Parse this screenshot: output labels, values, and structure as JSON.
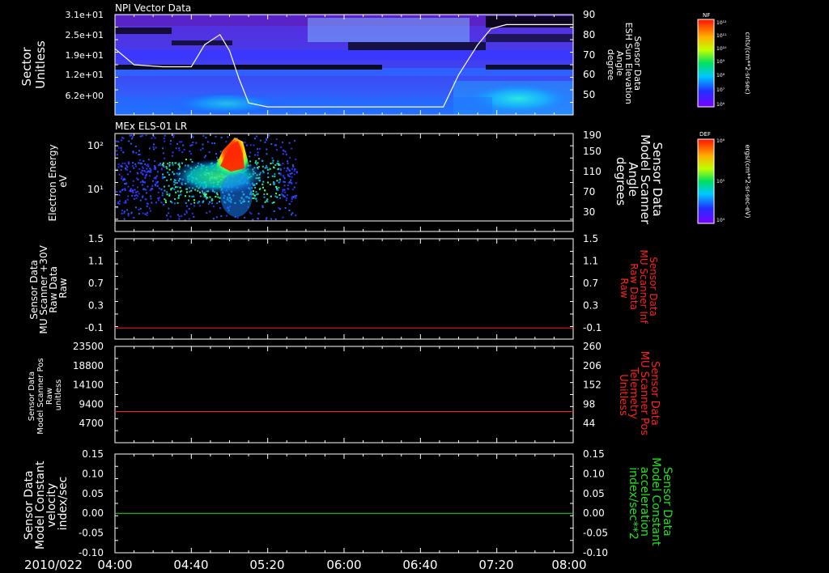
{
  "date_label": "2010/022",
  "time_ticks": [
    "04:00",
    "04:40",
    "05:20",
    "06:00",
    "06:40",
    "07:20",
    "08:00"
  ],
  "colors": {
    "frame": "#ffffff",
    "red": "#ff2020",
    "green": "#20e020",
    "background": "#000000"
  },
  "chart_data": [
    {
      "type": "heatmap",
      "title": "NPI Vector Data",
      "ylabel": [
        "Sector",
        "Unitless"
      ],
      "left_ticks": [
        "3.1e+01",
        "2.5e+01",
        "1.9e+01",
        "1.2e+01",
        "6.2e+00"
      ],
      "right_ticks": [
        "90",
        "80",
        "70",
        "60",
        "50"
      ],
      "right_label": [
        "Sensor Data",
        "ESH Sun Elevation",
        "Angle",
        "degree"
      ],
      "x": [
        "04:00",
        "08:00"
      ],
      "overlay_line": {
        "name": "ESH Sun Elevation",
        "x": [
          "04:00",
          "04:10",
          "04:25",
          "04:40",
          "04:47",
          "04:55",
          "05:00",
          "05:05",
          "05:10",
          "05:20",
          "06:00",
          "06:40",
          "06:52",
          "07:00",
          "07:10",
          "07:17",
          "07:25",
          "08:00"
        ],
        "y": [
          73,
          65,
          64,
          64,
          75,
          80,
          72,
          58,
          46,
          44,
          44,
          44,
          44,
          60,
          75,
          83,
          85,
          85
        ]
      },
      "colorbar": {
        "label": "NF",
        "tick_labels": [
          "10¹²",
          "10¹¹",
          "10¹⁰",
          "10⁹",
          "10⁸",
          "10⁷",
          "10⁶"
        ],
        "units": "cnts/(cm**2-sr-sec)"
      }
    },
    {
      "type": "heatmap",
      "title": "MEx ELS-01 LR",
      "ylabel": [
        "Electron Energy",
        "eV"
      ],
      "left_ticks": [
        "10²",
        "10¹"
      ],
      "right_ticks": [
        "190",
        "150",
        "110",
        "70",
        "30"
      ],
      "right_label": [
        "Sensor Data",
        "Model Scanner",
        "Angle",
        "degrees"
      ],
      "data_extent": [
        "04:00",
        "05:35"
      ],
      "overlay_line": {
        "name": "Model Scanner Angle",
        "y": 10
      },
      "colorbar": {
        "label": "DEF",
        "tick_labels": [
          "10⁶",
          "10⁵",
          "10⁴"
        ],
        "units": "ergs/(cm**2-sr-sec-eV)"
      }
    },
    {
      "type": "line",
      "ylabel": [
        "Sensor Data",
        "MU Scanner +30V",
        "Raw Data",
        "Raw"
      ],
      "left_ticks": [
        "1.5",
        "1.1",
        "0.7",
        "0.3",
        "-0.1"
      ],
      "right_ticks": [
        "1.5",
        "1.1",
        "0.7",
        "0.3",
        "-0.1"
      ],
      "right_label": [
        "Sensor Data",
        "MU Scanner Inf",
        "Raw Data",
        "Raw"
      ],
      "ylim": [
        -0.3,
        1.5
      ],
      "series": [
        {
          "name": "MU Scanner Inf Raw Data",
          "color": "#ff2020",
          "x": [
            "04:00",
            "08:00"
          ],
          "y": [
            -0.1,
            -0.1
          ]
        }
      ]
    },
    {
      "type": "line",
      "ylabel": [
        "Sensor Data",
        "Model Scanner Pos",
        "Raw",
        "unitless"
      ],
      "left_ticks": [
        "23500",
        "18800",
        "14100",
        "9400",
        "4700"
      ],
      "right_ticks": [
        "260",
        "206",
        "152",
        "98",
        "44"
      ],
      "right_label": [
        "Sensor Data",
        "MU Scanner Pos",
        "Telemetry",
        "Unitless"
      ],
      "ylim": [
        0,
        23500
      ],
      "series": [
        {
          "name": "MU Scanner Pos Telemetry",
          "color": "#ff2020",
          "x": [
            "04:00",
            "08:00"
          ],
          "y": [
            7600,
            7600
          ]
        }
      ]
    },
    {
      "type": "line",
      "ylabel": [
        "Sensor Data",
        "Model Constant",
        "velocity",
        "index/sec"
      ],
      "left_ticks": [
        "0.15",
        "0.10",
        "0.05",
        "0.00",
        "-0.05",
        "-0.10"
      ],
      "right_ticks": [
        "0.15",
        "0.10",
        "0.05",
        "0.00",
        "-0.05",
        "-0.10"
      ],
      "right_label": [
        "Sensor Data",
        "Model Constant",
        "acceleration",
        "index/sec**2"
      ],
      "ylim": [
        -0.1,
        0.15
      ],
      "series": [
        {
          "name": "Model Constant acceleration",
          "color": "#20e020",
          "x": [
            "04:00",
            "08:00"
          ],
          "y": [
            0.0,
            0.0
          ]
        }
      ]
    }
  ]
}
